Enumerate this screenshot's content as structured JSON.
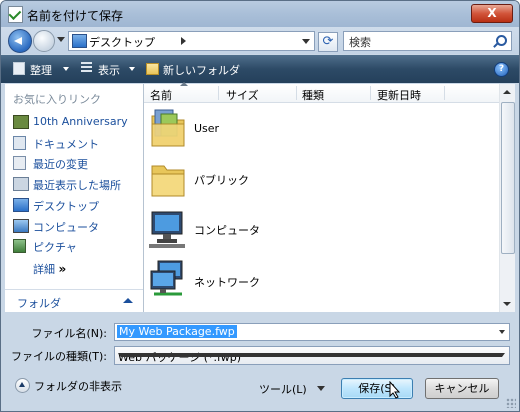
{
  "window": {
    "title": "名前を付けて保存",
    "close_label": "X"
  },
  "address": {
    "location": "デスクトップ",
    "search_placeholder": "検索"
  },
  "toolbar": {
    "organize": "整理",
    "views": "表示",
    "new_folder": "新しいフォルダ",
    "help": "?"
  },
  "sidebar": {
    "favorites_header": "お気に入りリンク",
    "items": [
      {
        "label": "10th Anniversary",
        "icon": "camera-icon"
      },
      {
        "label": "ドキュメント",
        "icon": "documents-icon"
      },
      {
        "label": "最近の変更",
        "icon": "recent-changes-icon"
      },
      {
        "label": "最近表示した場所",
        "icon": "recent-places-icon"
      },
      {
        "label": "デスクトップ",
        "icon": "desktop-icon"
      },
      {
        "label": "コンピュータ",
        "icon": "computer-icon"
      },
      {
        "label": "ピクチャ",
        "icon": "pictures-icon"
      }
    ],
    "more_label": "詳細",
    "more_chevron": "»",
    "folders_label": "フォルダ"
  },
  "columns": [
    "名前",
    "サイズ",
    "種類",
    "更新日時"
  ],
  "files": [
    {
      "name": "User",
      "icon": "user-folder-icon"
    },
    {
      "name": "パブリック",
      "icon": "folder-icon"
    },
    {
      "name": "コンピュータ",
      "icon": "computer-icon"
    },
    {
      "name": "ネットワーク",
      "icon": "network-icon"
    }
  ],
  "form": {
    "filename_label": "ファイル名(N):",
    "filename_value": "My Web Package.fwp",
    "filetype_label": "ファイルの種類(T):",
    "filetype_value": "Web パッケージ (*.fwp)"
  },
  "footer": {
    "hide_folders": "フォルダの非表示",
    "tools": "ツール(L)",
    "save": "保存(S)",
    "cancel": "キャンセル"
  }
}
